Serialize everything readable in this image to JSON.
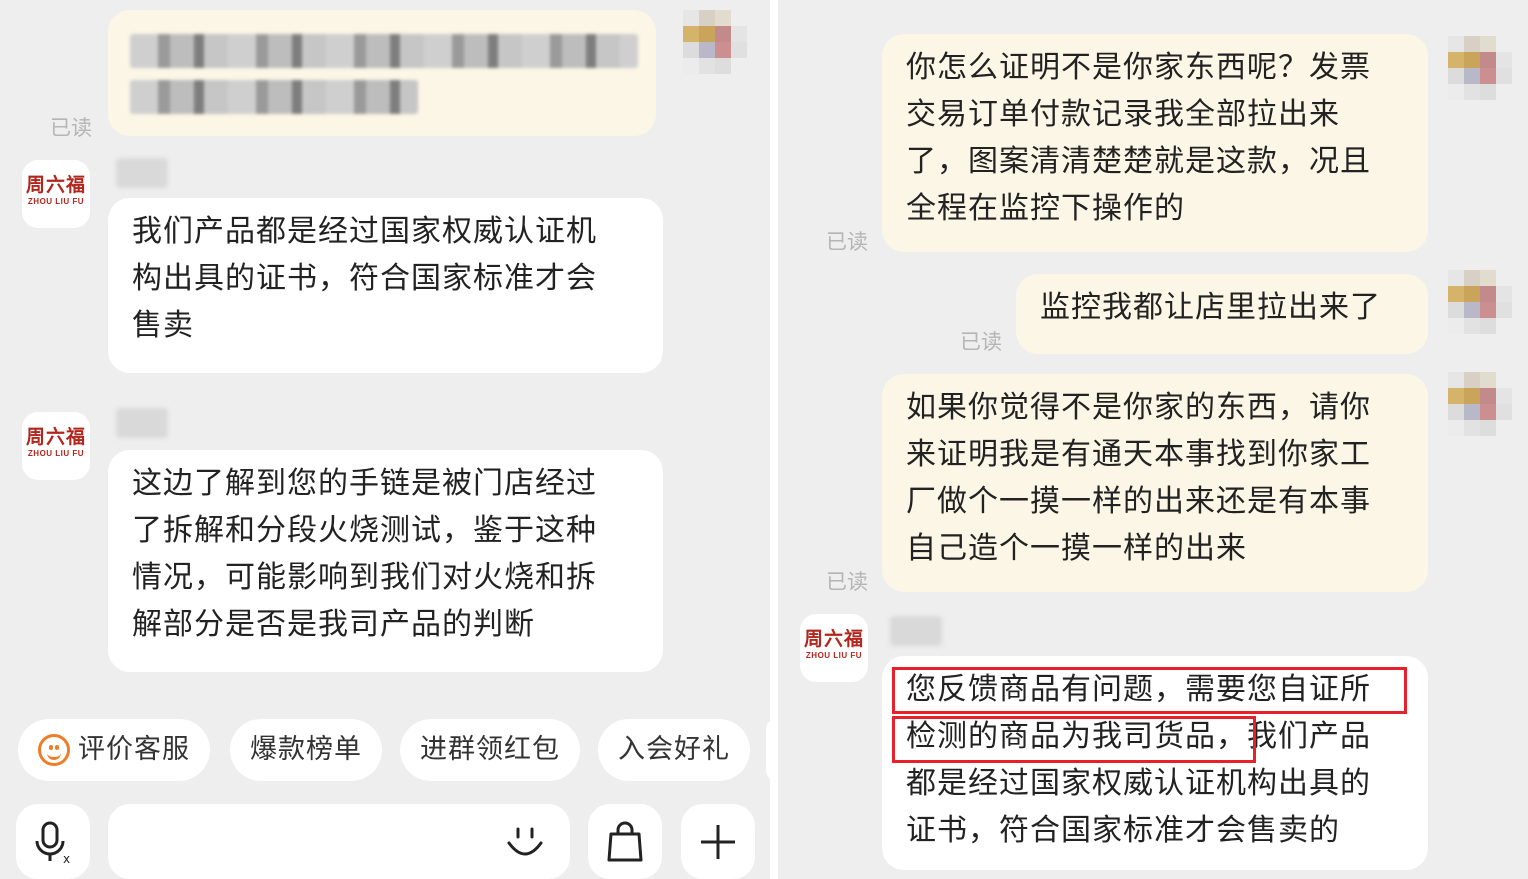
{
  "brand": {
    "logo_cn": "周六福",
    "logo_en": "ZHOU LIU FU"
  },
  "colors": {
    "highlight": "#e8202a",
    "incoming_bubble": "#ffffff",
    "outgoing_bubble": "#fbf6e6",
    "chip_icon": "#ef7d28"
  },
  "left": {
    "read_label": "已读",
    "messages": [
      {
        "text": "我们产品都是经过国家权威认证机\n构出具的证书，符合国家标准才会\n售卖"
      },
      {
        "text": "这边了解到您的手链是被门店经过\n了拆解和分段火烧测试，鉴于这种\n情况，可能影响到我们对火烧和拆\n解部分是否是我司产品的判断"
      }
    ],
    "chips": [
      {
        "label": "评价客服",
        "icon": "smile-icon"
      },
      {
        "label": "爆款榜单"
      },
      {
        "label": "进群领红包"
      },
      {
        "label": "入会好礼"
      }
    ],
    "input_icons": [
      "voice-input-icon",
      "emoji-icon",
      "shopping-bag-icon",
      "plus-icon"
    ]
  },
  "right": {
    "messages": [
      {
        "text": "你怎么证明不是你家东西呢？发票\n交易订单付款记录我全部拉出来\n了，图案清清楚楚就是这款，况且\n全程在监控下操作的",
        "read_label": "已读"
      },
      {
        "text": "监控我都让店里拉出来了",
        "read_label": "已读"
      },
      {
        "text": "如果你觉得不是你家的东西，请你\n来证明我是有通天本事找到你家工\n厂做个一摸一样的出来还是有本事\n自己造个一摸一样的出来",
        "read_label": "已读"
      },
      {
        "text": "您反馈商品有问题，需要您自证所\n检测的商品为我司货品，我们产品\n都是经过国家权威认证机构出具的\n证书，符合国家标准才会售卖的"
      }
    ]
  }
}
